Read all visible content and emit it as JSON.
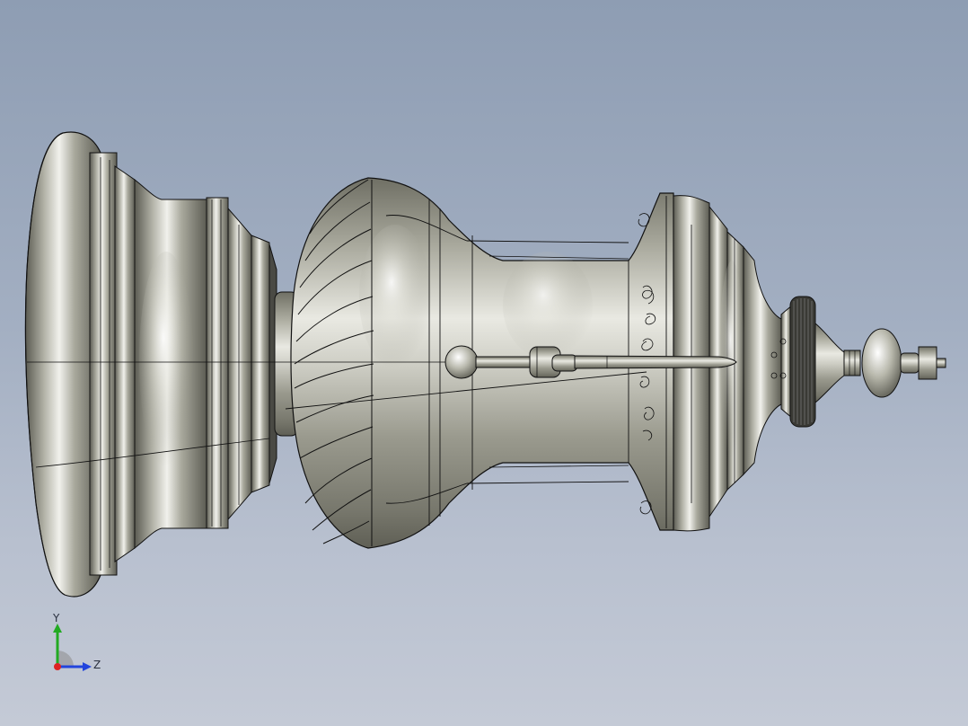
{
  "viewport": {
    "background_top": "#8e9db3",
    "background_bottom": "#c4cad6",
    "model": {
      "name": "",
      "body_color": "#9a9a8c",
      "highlight_color": "#f4f4ee",
      "edge_color": "#1a1a1a"
    }
  },
  "triad": {
    "y_label": "Y",
    "z_label": "Z",
    "y_color": "#22aa22",
    "z_color": "#2244dd",
    "x_color": "#dd2222"
  }
}
